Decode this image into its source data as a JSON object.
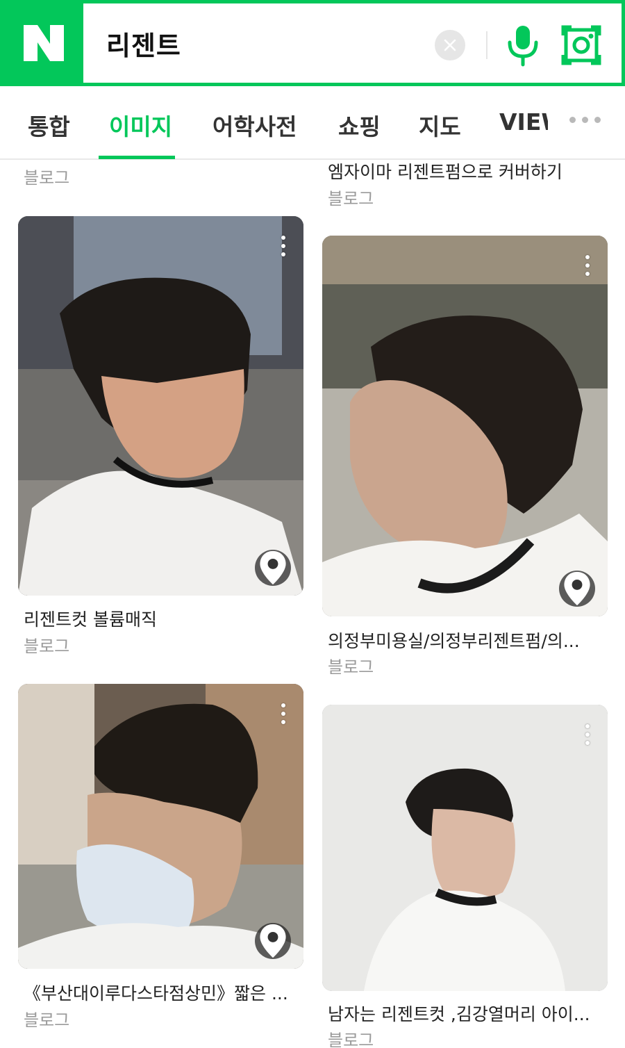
{
  "search": {
    "logo_letter": "N",
    "query": "리젠트",
    "brand_color": "#03c75a"
  },
  "tabs": [
    {
      "label": "통합",
      "active": false
    },
    {
      "label": "이미지",
      "active": true
    },
    {
      "label": "어학사전",
      "active": false
    },
    {
      "label": "쇼핑",
      "active": false
    },
    {
      "label": "지도",
      "active": false
    },
    {
      "label": "VIEW",
      "active": false
    }
  ],
  "partial_top": {
    "left_source": "블로그",
    "right_title": "엠자이마 리젠트펌으로 커버하기",
    "right_source": "블로그"
  },
  "results": [
    {
      "title": "리젠트컷 볼륨매직",
      "source": "블로그",
      "has_location": true
    },
    {
      "title": "의정부미용실/의정부리젠트펌/의...",
      "source": "블로그",
      "has_location": true
    },
    {
      "title": "《부산대이루다스타점상민》짧은 ...",
      "source": "블로그",
      "has_location": true
    },
    {
      "title": "남자는 리젠트컷 ,김강열머리 아이...",
      "source": "블로그",
      "has_location": false
    }
  ],
  "icons": {
    "clear": "close-icon",
    "mic": "microphone-icon",
    "lens": "camera-lens-icon",
    "more": "more-dots-icon",
    "kebab": "kebab-menu-icon",
    "location": "location-pin-icon"
  }
}
